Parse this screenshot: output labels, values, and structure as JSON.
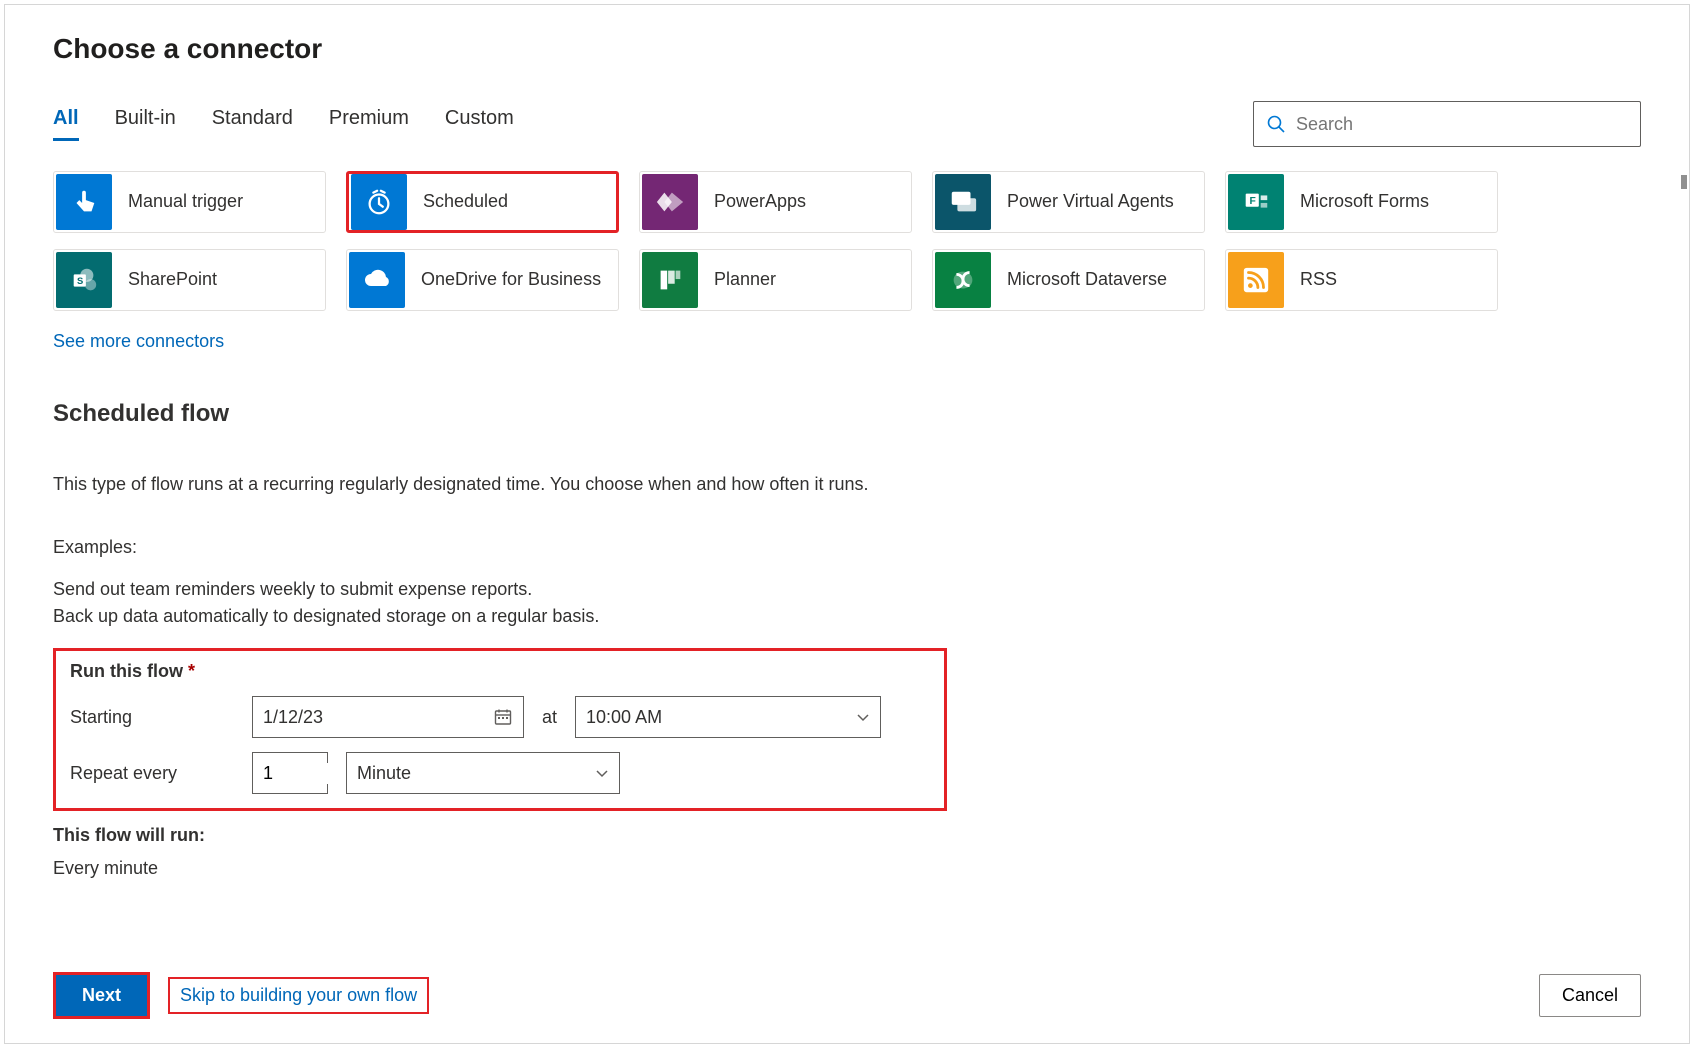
{
  "header": {
    "title": "Choose a connector"
  },
  "tabs": {
    "items": [
      {
        "label": "All",
        "active": true
      },
      {
        "label": "Built-in",
        "active": false
      },
      {
        "label": "Standard",
        "active": false
      },
      {
        "label": "Premium",
        "active": false
      },
      {
        "label": "Custom",
        "active": false
      }
    ]
  },
  "search": {
    "placeholder": "Search"
  },
  "connectors": {
    "items": [
      {
        "label": "Manual trigger",
        "icon": "hand-tap-icon",
        "color": "#0078d4",
        "highlighted": false
      },
      {
        "label": "Scheduled",
        "icon": "clock-icon",
        "color": "#0078d4",
        "highlighted": true
      },
      {
        "label": "PowerApps",
        "icon": "diamond-icon",
        "color": "#742774",
        "highlighted": false
      },
      {
        "label": "Power Virtual Agents",
        "icon": "chat-icon",
        "color": "#0b556a",
        "highlighted": false
      },
      {
        "label": "Microsoft Forms",
        "icon": "forms-icon",
        "color": "#008272",
        "highlighted": false
      },
      {
        "label": "SharePoint",
        "icon": "sharepoint-icon",
        "color": "#036c70",
        "highlighted": false
      },
      {
        "label": "OneDrive for Business",
        "icon": "cloud-icon",
        "color": "#0078d4",
        "highlighted": false
      },
      {
        "label": "Planner",
        "icon": "planner-icon",
        "color": "#107c41",
        "highlighted": false
      },
      {
        "label": "Microsoft Dataverse",
        "icon": "dataverse-icon",
        "color": "#088142",
        "highlighted": false
      },
      {
        "label": "RSS",
        "icon": "rss-icon",
        "color": "#f7a01b",
        "highlighted": false
      }
    ],
    "see_more": "See more connectors"
  },
  "scheduled": {
    "heading": "Scheduled flow",
    "description": "This type of flow runs at a recurring regularly designated time. You choose when and how often it runs.",
    "examples_label": "Examples:",
    "examples": [
      "Send out team reminders weekly to submit expense reports.",
      "Back up data automatically to designated storage on a regular basis."
    ],
    "run_title": "Run this flow",
    "required_marker": "*",
    "starting_label": "Starting",
    "starting_date": "1/12/23",
    "at_label": "at",
    "starting_time": "10:00 AM",
    "repeat_label": "Repeat every",
    "repeat_value": "1",
    "repeat_unit": "Minute",
    "will_run_label": "This flow will run:",
    "will_run_value": "Every minute"
  },
  "footer": {
    "next": "Next",
    "skip": "Skip to building your own flow",
    "cancel": "Cancel"
  }
}
